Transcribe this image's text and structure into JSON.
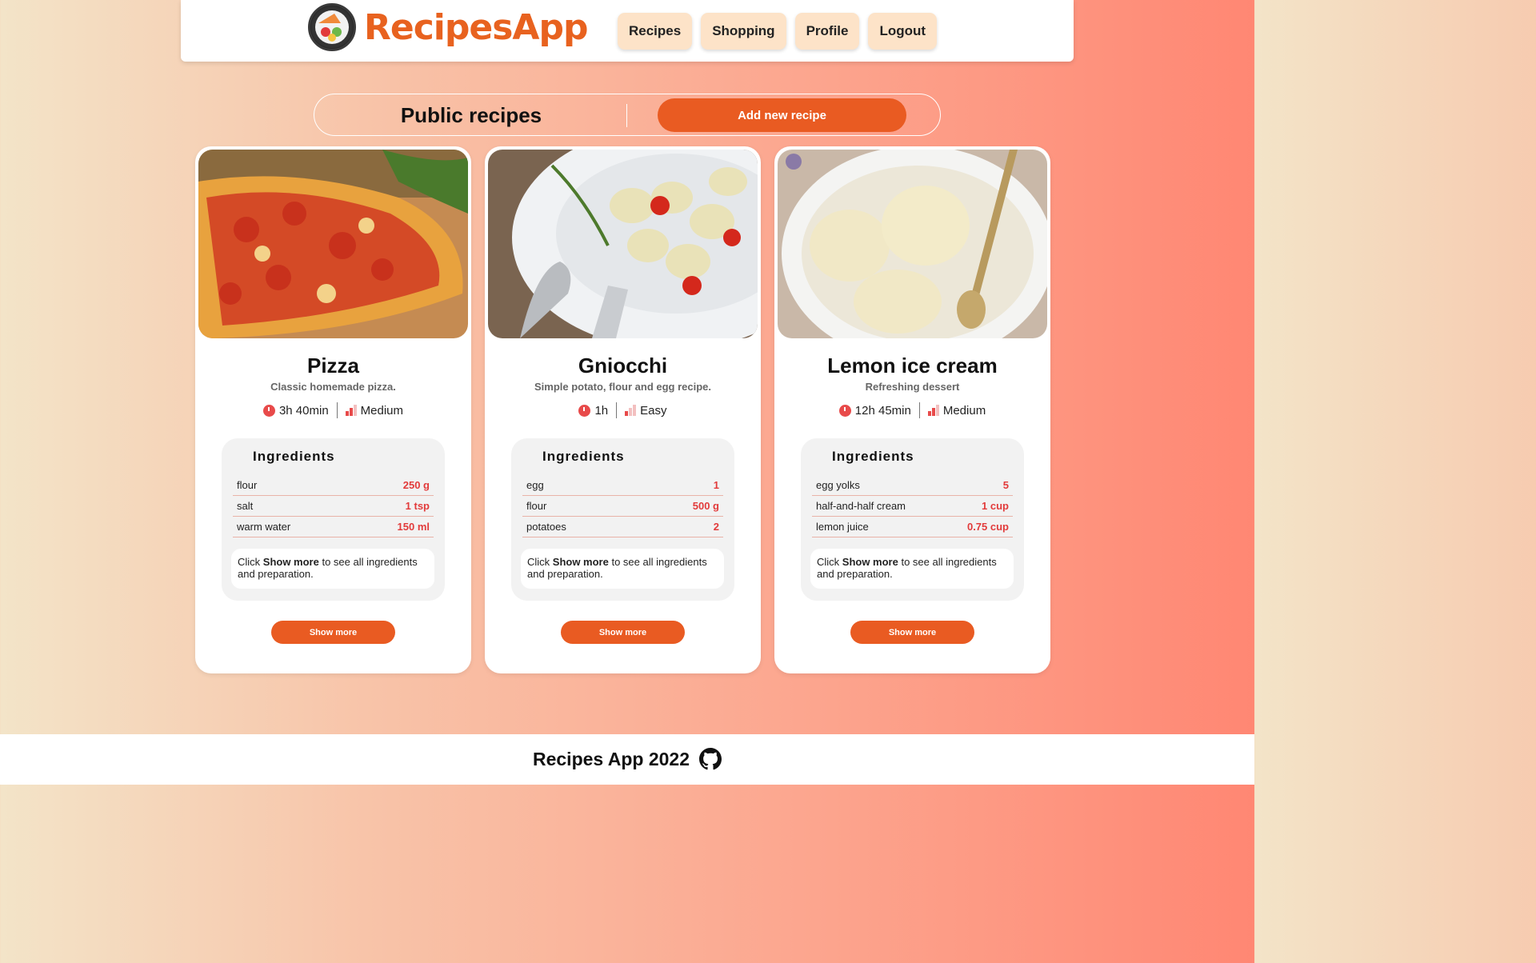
{
  "header": {
    "logo_text": "RecipesApp",
    "nav": [
      {
        "label": "Recipes"
      },
      {
        "label": "Shopping"
      },
      {
        "label": "Profile"
      },
      {
        "label": "Logout"
      }
    ]
  },
  "page": {
    "title": "Public recipes",
    "add_button": "Add new recipe"
  },
  "recipes": [
    {
      "title": "Pizza",
      "description": "Classic homemade pizza.",
      "time": "3h 40min",
      "difficulty": "Medium",
      "ingredients_title": "Ingredients",
      "ingredients": [
        {
          "name": "flour",
          "qty": "250 g"
        },
        {
          "name": "salt",
          "qty": "1 tsp"
        },
        {
          "name": "warm water",
          "qty": "150 ml"
        }
      ],
      "hint_prefix": "Click ",
      "hint_bold": "Show more",
      "hint_suffix": " to see all ingredients and preparation.",
      "show_more": "Show more"
    },
    {
      "title": "Gniocchi",
      "description": "Simple potato, flour and egg recipe.",
      "time": "1h",
      "difficulty": "Easy",
      "ingredients_title": "Ingredients",
      "ingredients": [
        {
          "name": "egg",
          "qty": "1"
        },
        {
          "name": "flour",
          "qty": "500 g"
        },
        {
          "name": "potatoes",
          "qty": "2"
        }
      ],
      "hint_prefix": "Click ",
      "hint_bold": "Show more",
      "hint_suffix": " to see all ingredients and preparation.",
      "show_more": "Show more"
    },
    {
      "title": "Lemon ice cream",
      "description": "Refreshing dessert",
      "time": "12h 45min",
      "difficulty": "Medium",
      "ingredients_title": "Ingredients",
      "ingredients": [
        {
          "name": "egg yolks",
          "qty": "5"
        },
        {
          "name": "half-and-half cream",
          "qty": "1 cup"
        },
        {
          "name": "lemon juice",
          "qty": "0.75 cup"
        }
      ],
      "hint_prefix": "Click ",
      "hint_bold": "Show more",
      "hint_suffix": " to see all ingredients and preparation.",
      "show_more": "Show more"
    }
  ],
  "footer": {
    "text": "Recipes App 2022",
    "icon": "github-icon"
  },
  "colors": {
    "accent": "#e95b22",
    "qty": "#e23b3b",
    "nav_bg": "#fde3c8"
  }
}
